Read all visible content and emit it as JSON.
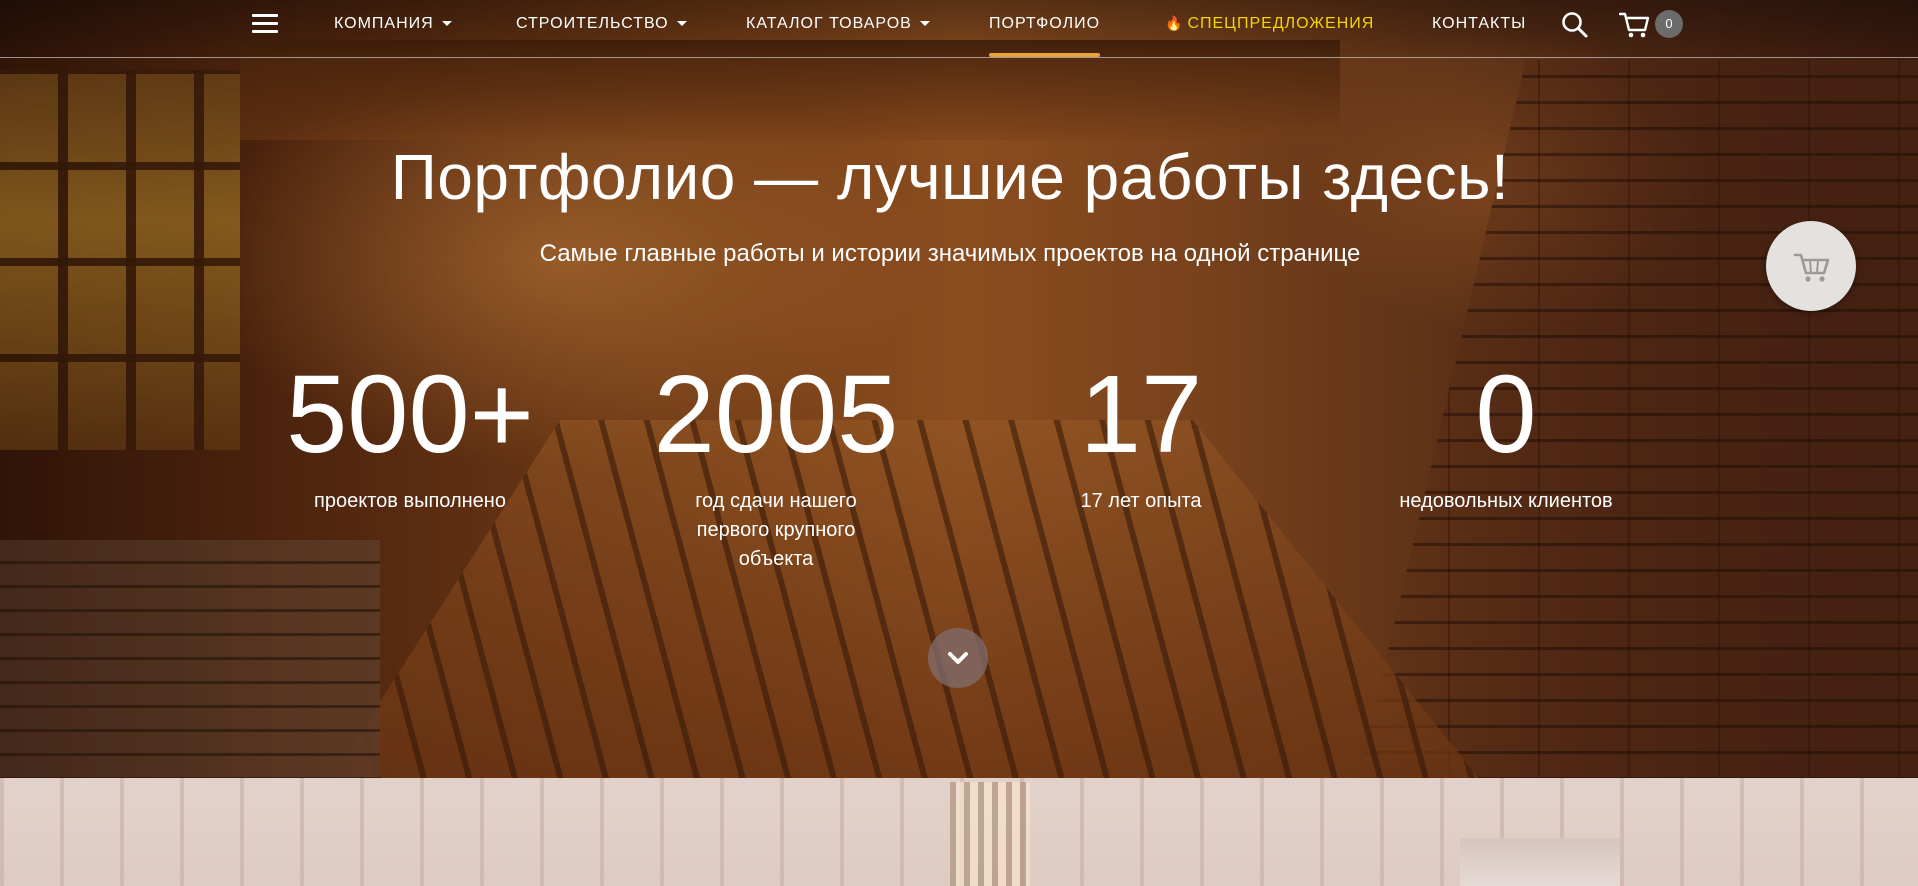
{
  "nav": {
    "items": [
      {
        "label": "КОМПАНИЯ",
        "dropdown": true
      },
      {
        "label": "СТРОИТЕЛЬСТВО",
        "dropdown": true
      },
      {
        "label": "КАТАЛОГ ТОВАРОВ",
        "dropdown": true
      },
      {
        "label": "ПОРТФОЛИО",
        "active": true
      },
      {
        "label": "СПЕЦПРЕДЛОЖЕНИЯ",
        "icon": "flame-icon"
      },
      {
        "label": "КОНТАКТЫ"
      }
    ],
    "cart_count": "0",
    "accent_color": "#e8a33a",
    "special_color": "#f5d400"
  },
  "hero": {
    "title": "Портфолио — лучшие работы здесь!",
    "subtitle": "Самые главные работы и истории значимых проектов на одной странице",
    "stats": [
      {
        "value": "500+",
        "label": "проектов выполнено"
      },
      {
        "value": "2005",
        "label": "год сдачи нашего первого крупного объекта"
      },
      {
        "value": "17",
        "label": "17 лет опыта"
      },
      {
        "value": "0",
        "label": "недовольных клиентов"
      }
    ]
  }
}
